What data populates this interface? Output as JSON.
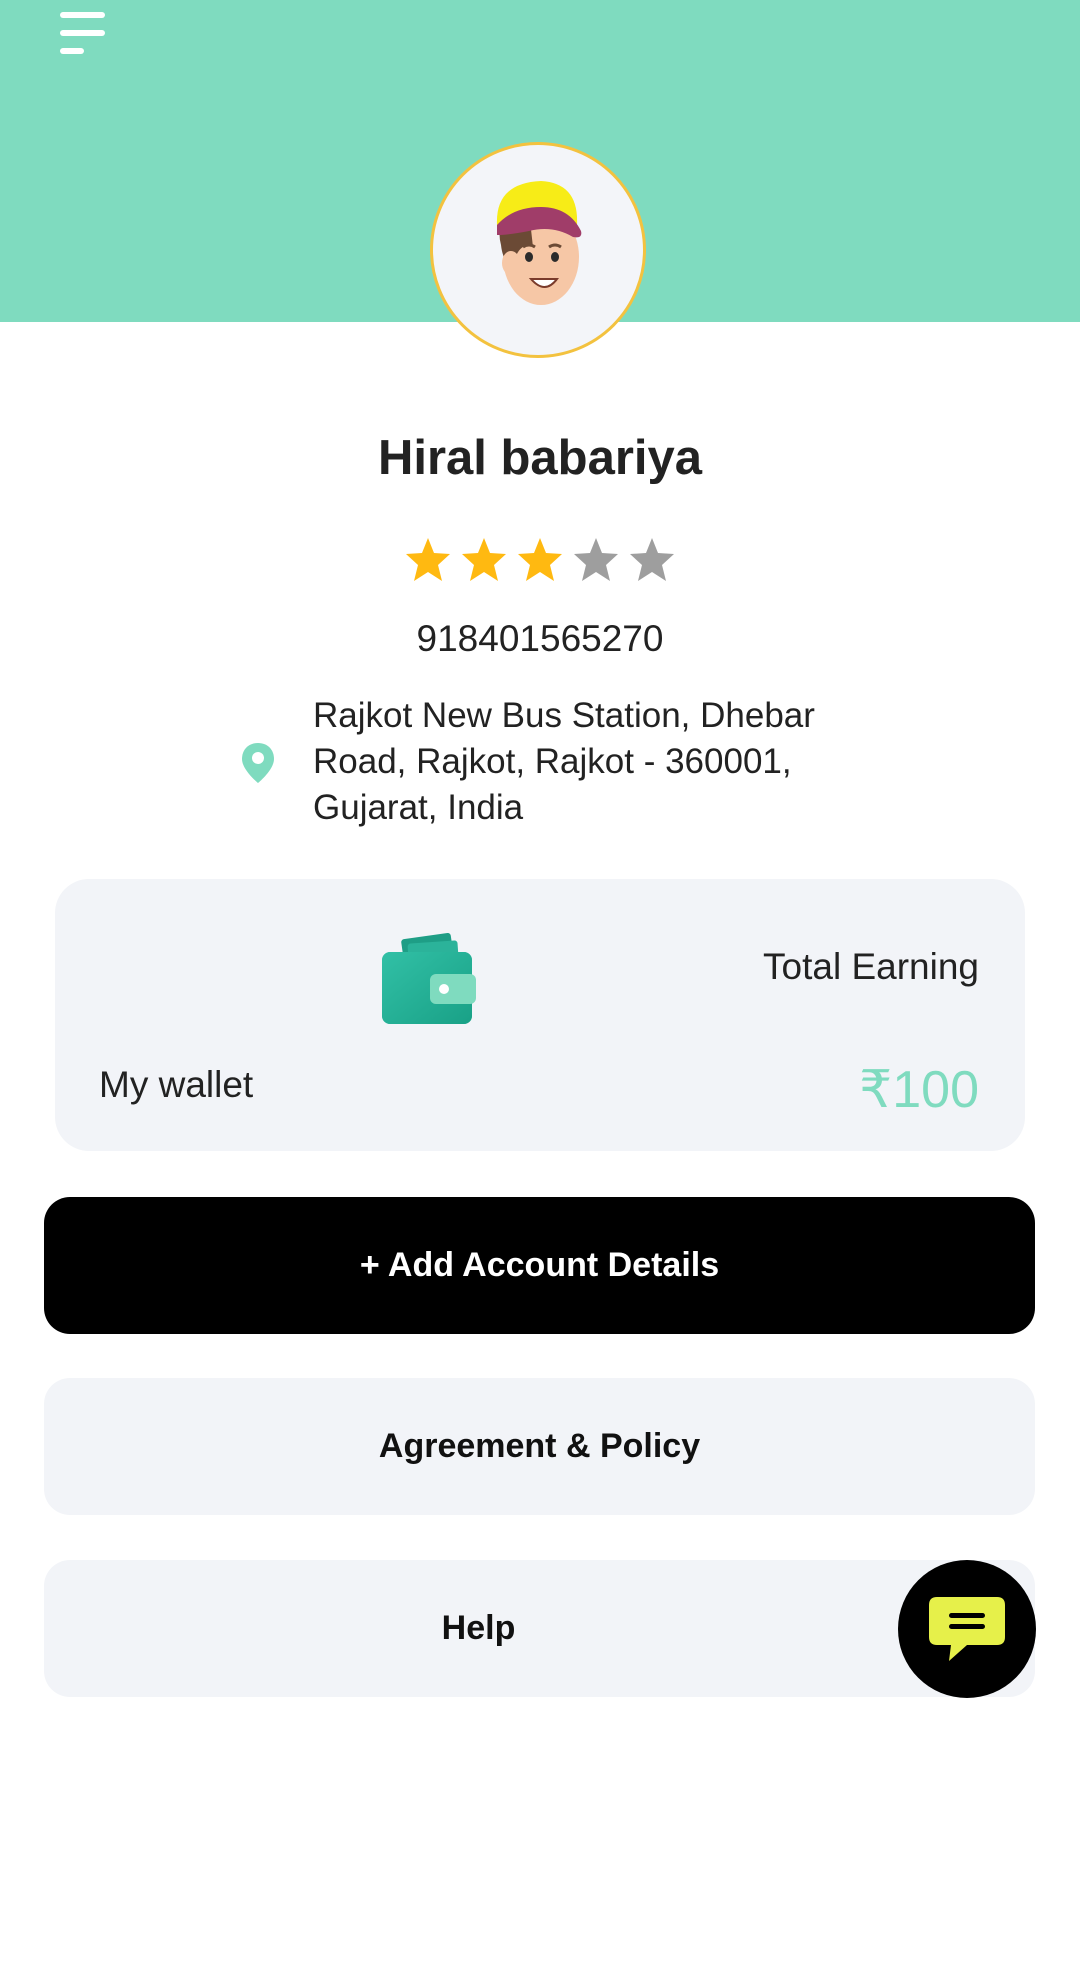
{
  "profile": {
    "name": "Hiral babariya",
    "rating": 3,
    "rating_max": 5,
    "phone": "918401565270",
    "address": "Rajkot New Bus Station, Dhebar Road, Rajkot, Rajkot - 360001, Gujarat, India"
  },
  "wallet": {
    "label": "My wallet",
    "earning_label": "Total Earning",
    "earning_amount": "₹100"
  },
  "actions": {
    "add_account": "+ Add Account Details",
    "agreement": "Agreement & Policy",
    "help": "Help"
  },
  "colors": {
    "header": "#7fdbbf",
    "star_filled": "#ffb911",
    "star_empty": "#9e9e9e",
    "accent": "#7fdbbf",
    "chat_bubble": "#e6f04a"
  },
  "icons": {
    "menu": "hamburger-menu-icon",
    "location": "map-pin-icon",
    "wallet": "wallet-icon",
    "chat": "chat-bubble-icon"
  }
}
